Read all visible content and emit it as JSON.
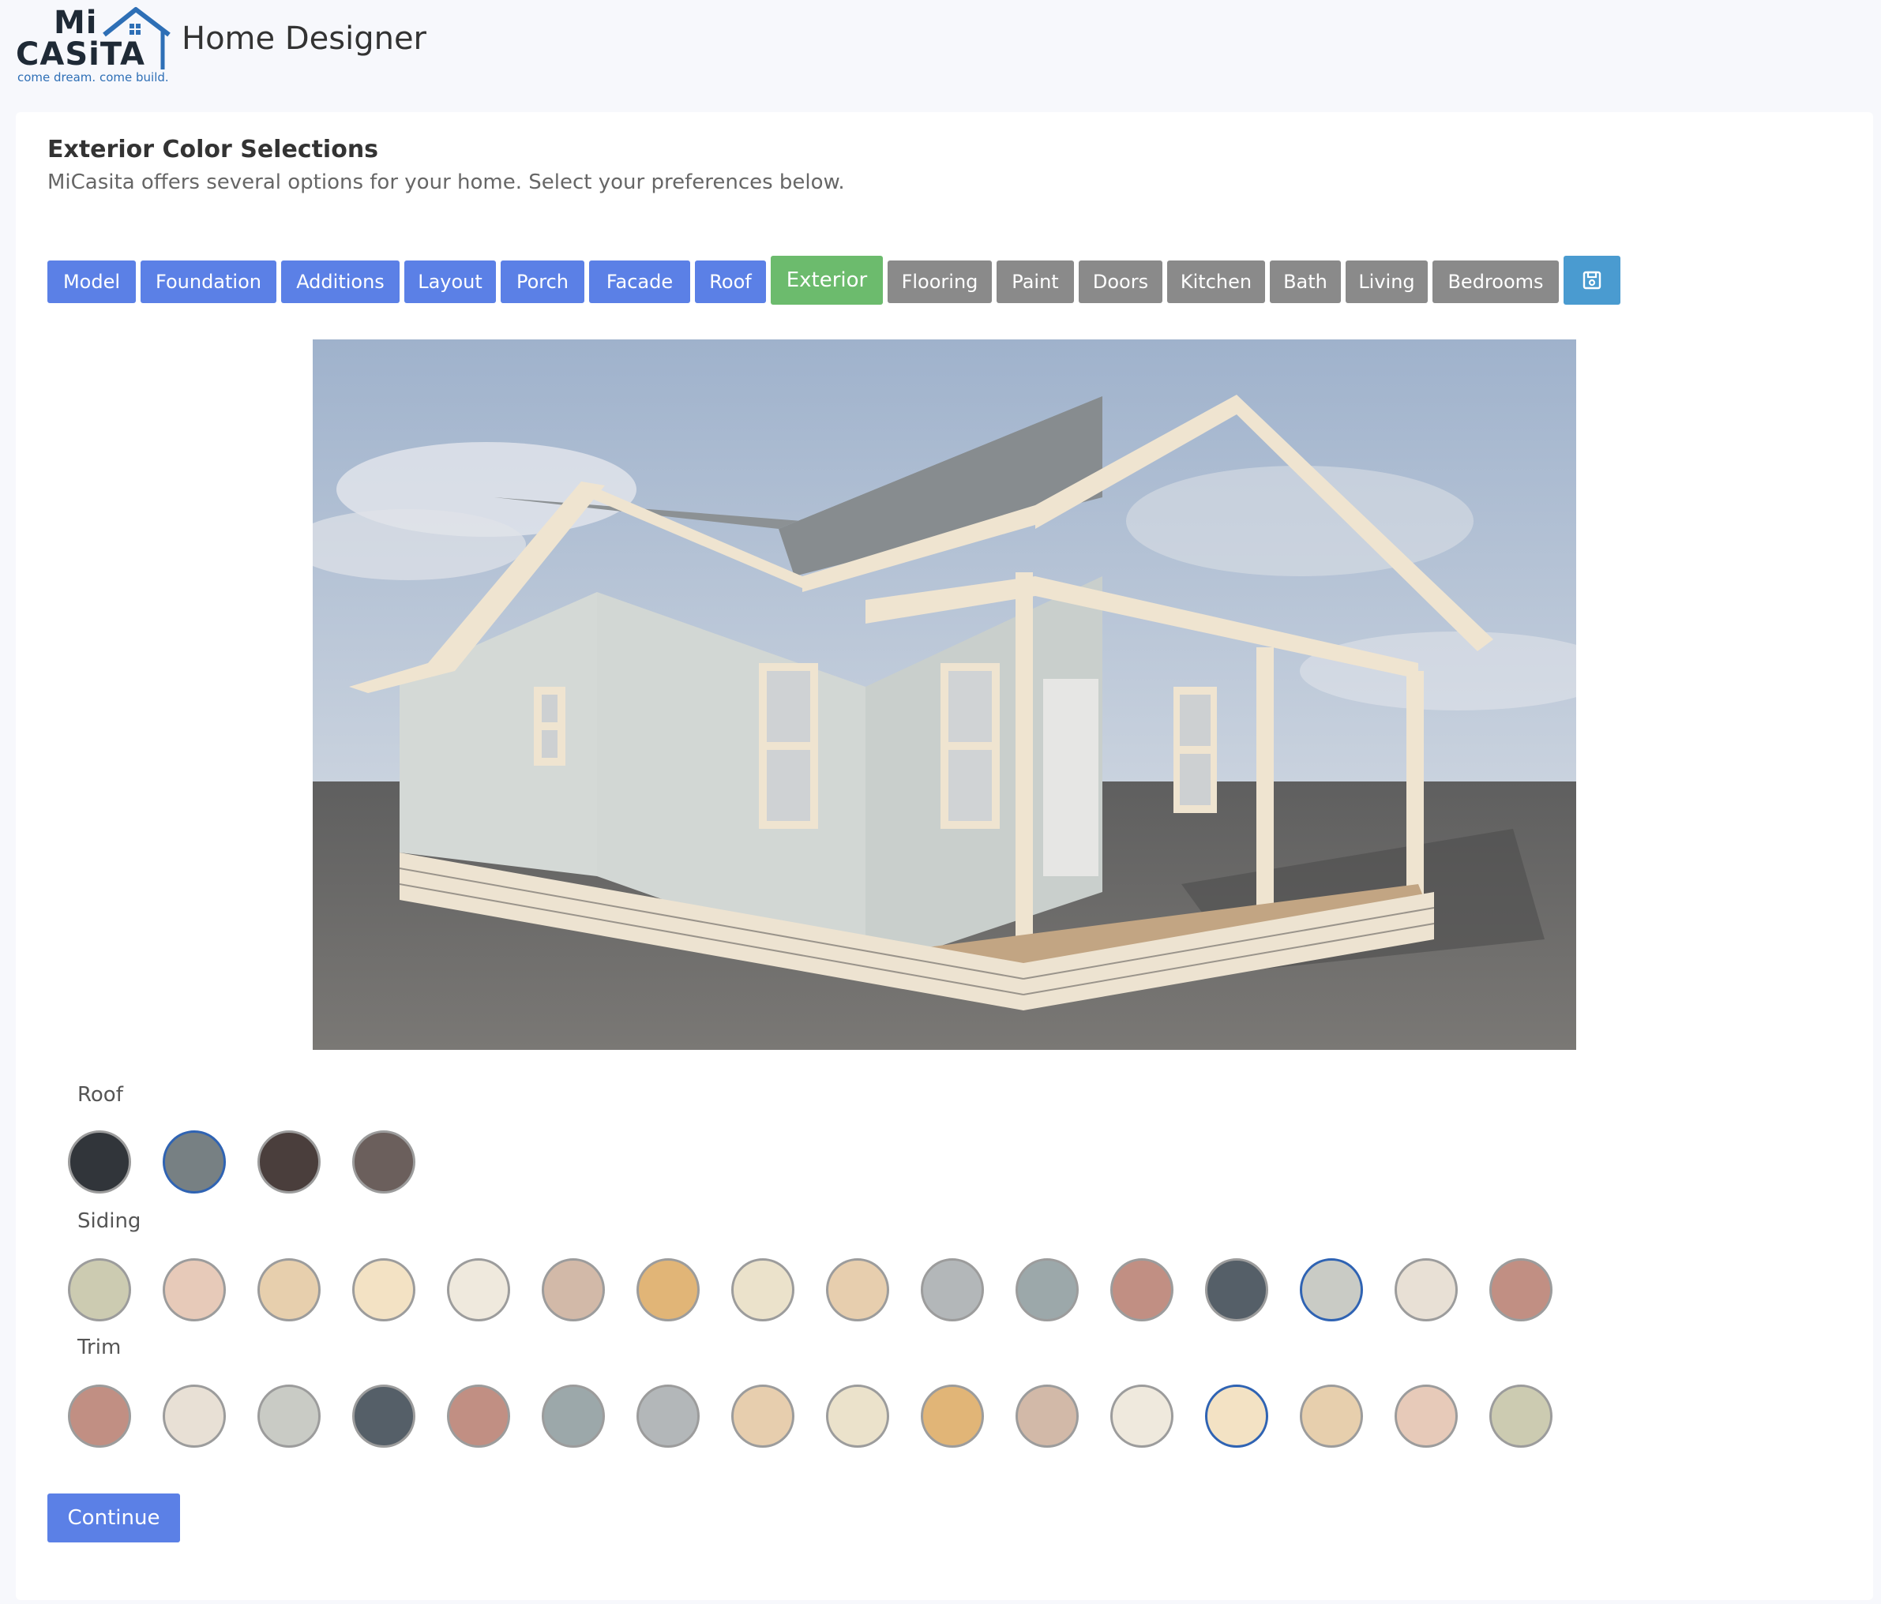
{
  "header": {
    "logo_top": "Mi",
    "logo_bottom": "CASiTA",
    "logo_tagline": "come dream. come build.",
    "app_title": "Home Designer"
  },
  "section": {
    "title": "Exterior Color Selections",
    "subtitle": "MiCasita offers several options for your home. Select your preferences below."
  },
  "tabs": [
    {
      "label": "Model",
      "state": "done"
    },
    {
      "label": "Foundation",
      "state": "done"
    },
    {
      "label": "Additions",
      "state": "done"
    },
    {
      "label": "Layout",
      "state": "done"
    },
    {
      "label": "Porch",
      "state": "done"
    },
    {
      "label": "Facade",
      "state": "done"
    },
    {
      "label": "Roof",
      "state": "done"
    },
    {
      "label": "Exterior",
      "state": "active"
    },
    {
      "label": "Flooring",
      "state": "todo"
    },
    {
      "label": "Paint",
      "state": "todo"
    },
    {
      "label": "Doors",
      "state": "todo"
    },
    {
      "label": "Kitchen",
      "state": "todo"
    },
    {
      "label": "Bath",
      "state": "todo"
    },
    {
      "label": "Living",
      "state": "todo"
    },
    {
      "label": "Bedrooms",
      "state": "todo"
    }
  ],
  "save_icon": "floppy-disk-icon",
  "color_groups": [
    {
      "label": "Roof",
      "selected_index": 1,
      "colors": [
        "#31353a",
        "#778083",
        "#4a3e3c",
        "#6b5f5c"
      ]
    },
    {
      "label": "Siding",
      "selected_index": 13,
      "colors": [
        "#cccbb1",
        "#e7cab9",
        "#e7cfad",
        "#f3e2c4",
        "#efe9dd",
        "#d2b9a8",
        "#e1b577",
        "#ebe2cb",
        "#e7ceae",
        "#b3b7b9",
        "#9ca8aa",
        "#c18f83",
        "#555f68",
        "#c9cbc5",
        "#e8e0d5",
        "#c18f83"
      ]
    },
    {
      "label": "Trim",
      "selected_index": 12,
      "colors": [
        "#c18f83",
        "#e8e0d5",
        "#c9cbc5",
        "#555f68",
        "#c18f83",
        "#9ca8aa",
        "#b3b7b9",
        "#e7ceae",
        "#ebe2cb",
        "#e1b577",
        "#d2b9a8",
        "#efe9dd",
        "#f3e2c4",
        "#e7cfad",
        "#e7cab9",
        "#cccbb1"
      ]
    }
  ],
  "continue_label": "Continue",
  "brand_colors": {
    "done_tab": "#5b80e6",
    "active_tab": "#6cbb6d",
    "todo_tab": "#8a8a8a",
    "save_tab": "#4a9bd0",
    "selected_border": "#2f63b3"
  }
}
